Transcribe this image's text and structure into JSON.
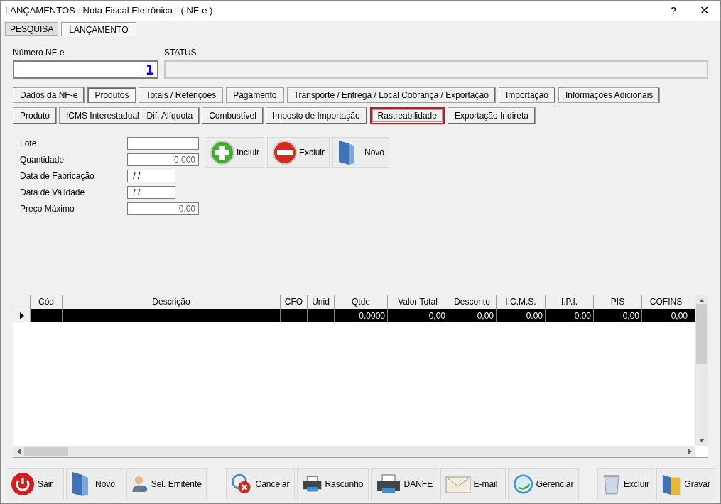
{
  "window": {
    "title": "LANÇAMENTOS : Nota Fiscal Eletrônica - ( NF-e )",
    "help": "?",
    "close": "✕"
  },
  "top_tabs": [
    {
      "label": "PESQUISA",
      "selected": false
    },
    {
      "label": "LANÇAMENTO",
      "selected": true
    }
  ],
  "numero": {
    "label": "Número NF-e",
    "value": "1"
  },
  "status": {
    "label": "STATUS"
  },
  "section_tabs": [
    {
      "label": "Dados da NF-e",
      "selected": false
    },
    {
      "label": "Produtos",
      "selected": true
    },
    {
      "label": "Totais / Retenções",
      "selected": false
    },
    {
      "label": "Pagamento",
      "selected": false
    },
    {
      "label": "Transporte / Entrega / Local Cobrança / Exportação",
      "selected": false
    },
    {
      "label": "Importação",
      "selected": false
    },
    {
      "label": "Informações Adicionais",
      "selected": false
    }
  ],
  "product_tabs": [
    {
      "label": "Produto",
      "selected": false
    },
    {
      "label": "ICMS Interestadual - Dif. Alíquota",
      "selected": false
    },
    {
      "label": "Combustível",
      "selected": false
    },
    {
      "label": "Imposto de Importação",
      "selected": false
    },
    {
      "label": "Rastreabilidade",
      "selected": true
    },
    {
      "label": "Exportação Indireta",
      "selected": false
    }
  ],
  "form_fields": [
    {
      "label": "Lote",
      "kind": "text"
    },
    {
      "label": "Quantidade",
      "value": "0,000",
      "kind": "number"
    },
    {
      "label": "Data de Fabricação",
      "value": " / /",
      "kind": "date"
    },
    {
      "label": "Data de Validade",
      "value": " / /",
      "kind": "date"
    },
    {
      "label": "Preço Máximo",
      "value": "0,00",
      "kind": "number"
    }
  ],
  "form_buttons": [
    "Incluir",
    "Excluir",
    "Novo"
  ],
  "table": {
    "columns": [
      "Cód",
      "Descrição",
      "CFO",
      "Unid",
      "Qtde",
      "Valor Total",
      "Desconto",
      "I.C.M.S.",
      "I.P.I.",
      "PIS",
      "COFINS"
    ],
    "rows": [
      {
        "selected": true,
        "cells": [
          "",
          "",
          "",
          "",
          "0.0000",
          "0,00",
          "0,00",
          "0.00",
          "0.00",
          "0,00",
          "0,00"
        ]
      }
    ]
  },
  "bottom_button_groups": [
    [
      "Sair",
      "Novo",
      "Sel. Emitente"
    ],
    [
      "Cancelar",
      "Rascunho",
      "DANFE",
      "E-mail",
      "Gerenciar"
    ],
    [
      "Excluir",
      "Gravar"
    ]
  ]
}
